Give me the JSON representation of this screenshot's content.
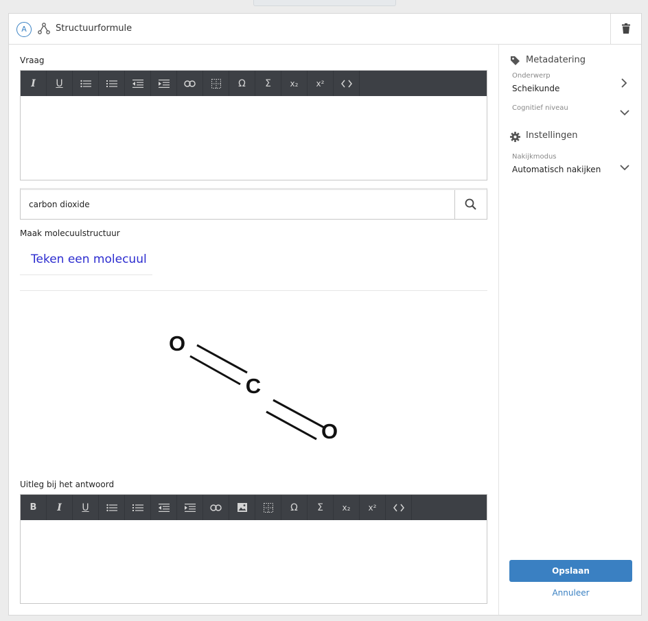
{
  "header": {
    "badge": "A",
    "title": "Structuurformule"
  },
  "question": {
    "label": "Vraag",
    "toolbar": [
      {
        "icon": "italic-icon",
        "glyph": "I"
      },
      {
        "icon": "underline-icon",
        "glyph": "U"
      },
      {
        "icon": "bullet-list-icon",
        "glyph": ""
      },
      {
        "icon": "numbered-list-icon",
        "glyph": ""
      },
      {
        "icon": "outdent-icon",
        "glyph": ""
      },
      {
        "icon": "indent-icon",
        "glyph": ""
      },
      {
        "icon": "link-icon",
        "glyph": ""
      },
      {
        "icon": "table-icon",
        "glyph": ""
      },
      {
        "icon": "omega-icon",
        "glyph": "Ω"
      },
      {
        "icon": "sigma-icon",
        "glyph": "Σ"
      },
      {
        "icon": "subscript-icon",
        "glyph": "x₂"
      },
      {
        "icon": "superscript-icon",
        "glyph": "x²"
      },
      {
        "icon": "code-icon",
        "glyph": "<>"
      }
    ]
  },
  "search": {
    "value": "carbon dioxide"
  },
  "molecule": {
    "label": "Maak molecuulstructuur",
    "draw_link": "Teken een molecuul",
    "atoms": [
      "O",
      "C",
      "O"
    ]
  },
  "explanation": {
    "label": "Uitleg bij het antwoord",
    "toolbar": [
      {
        "icon": "bold-icon",
        "glyph": "B"
      },
      {
        "icon": "italic-icon",
        "glyph": "I"
      },
      {
        "icon": "underline-icon",
        "glyph": "U"
      },
      {
        "icon": "bullet-list-icon",
        "glyph": ""
      },
      {
        "icon": "numbered-list-icon",
        "glyph": ""
      },
      {
        "icon": "outdent-icon",
        "glyph": ""
      },
      {
        "icon": "indent-icon",
        "glyph": ""
      },
      {
        "icon": "link-icon",
        "glyph": ""
      },
      {
        "icon": "image-icon",
        "glyph": ""
      },
      {
        "icon": "table-icon",
        "glyph": ""
      },
      {
        "icon": "omega-icon",
        "glyph": "Ω"
      },
      {
        "icon": "sigma-icon",
        "glyph": "Σ"
      },
      {
        "icon": "subscript-icon",
        "glyph": "x₂"
      },
      {
        "icon": "superscript-icon",
        "glyph": "x²"
      },
      {
        "icon": "code-icon",
        "glyph": "<>"
      }
    ]
  },
  "sidebar": {
    "metadata_title": "Metadatering",
    "subject_label": "Onderwerp",
    "subject_value": "Scheikunde",
    "cognitive_label": "Cognitief niveau",
    "settings_title": "Instellingen",
    "grading_label": "Nakijkmodus",
    "grading_value": "Automatisch nakijken"
  },
  "actions": {
    "save": "Opslaan",
    "cancel": "Annuleer"
  },
  "colors": {
    "accent": "#3a80c2",
    "toolbar": "#3d4045",
    "link": "#2b2bcf"
  }
}
